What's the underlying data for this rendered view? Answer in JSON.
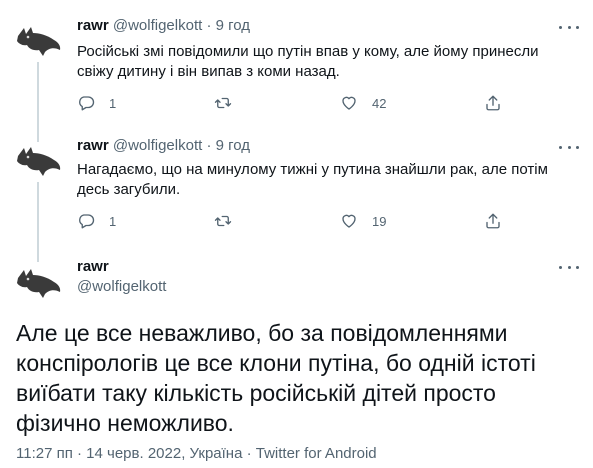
{
  "replies": [
    {
      "name": "rawr",
      "handle": "@wolfigelkott",
      "separator": "·",
      "time": "9 год",
      "text": "Російські змі повідомили що путін впав у кому, але йому принесли свіжу дитину і він випав з коми назад.",
      "reply_count": "1",
      "retweet_count": "",
      "like_count": "42"
    },
    {
      "name": "rawr",
      "handle": "@wolfigelkott",
      "separator": "·",
      "time": "9 год",
      "text": "Нагадаємо, що на минулому тижні у путина знайшли рак, але потім десь загубили.",
      "reply_count": "1",
      "retweet_count": "",
      "like_count": "19"
    }
  ],
  "main": {
    "name": "rawr",
    "handle": "@wolfigelkott",
    "text": "Але це все неважливо, бо за повідомленнями конспірологів це все клони путіна, бо одній істоті виїбати таку кількість російській дітей просто фізично неможливо.",
    "meta": "11:27 пп · 14 черв. 2022, Україна · Twitter for Android"
  },
  "icons": {
    "reply": "reply-icon",
    "retweet": "retweet-icon",
    "like": "heart-icon",
    "share": "share-icon",
    "more": "more-icon",
    "avatar": "wolf-avatar"
  },
  "colors": {
    "text": "#0f1419",
    "secondary": "#536471",
    "thread_line": "#cfd9de"
  }
}
